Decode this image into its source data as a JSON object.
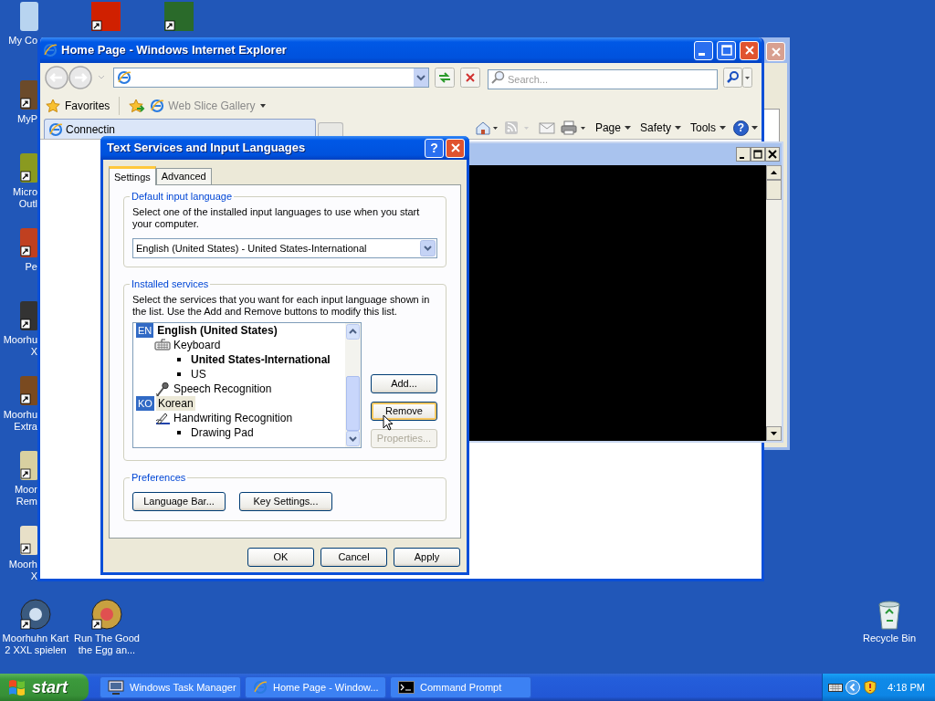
{
  "desktop": {
    "left_icons": [
      {
        "label": "My Co"
      },
      {
        "label": "MyP"
      },
      {
        "label": "Micro\nOutl"
      },
      {
        "label": "Pe"
      },
      {
        "label": "Moorhu\nX"
      },
      {
        "label": "Moorhu\nExtra"
      },
      {
        "label": "Moor\nRem"
      },
      {
        "label": "Moorh\nX"
      }
    ],
    "bottom_icons": [
      {
        "label": "Moorhuhn Kart\n2 XXL spielen"
      },
      {
        "label": "Run The Good\nthe Egg an..."
      }
    ],
    "recycle_bin": {
      "label": "Recycle Bin"
    }
  },
  "ie_window": {
    "title": "Home Page - Windows Internet Explorer",
    "search": {
      "placeholder": "Search..."
    },
    "favorites": "Favorites",
    "web_slice": "Web Slice Gallery",
    "tabs": [
      {
        "label": "Connectin",
        "selected": true
      }
    ],
    "command_bar": [
      {
        "label": "Page"
      },
      {
        "label": "Safety"
      },
      {
        "label": "Tools"
      }
    ],
    "help_button": "?"
  },
  "dialog": {
    "title": "Text Services and Input Languages",
    "help_button": "?",
    "tabs": [
      {
        "label": "Settings",
        "selected": true
      },
      {
        "label": "Advanced",
        "selected": false
      }
    ],
    "default_language": {
      "heading": "Default input language",
      "description": "Select one of the installed input languages to use when you start your computer.",
      "value": "English (United States) - United States-International"
    },
    "installed_services": {
      "heading": "Installed services",
      "description": "Select the services that you want for each input language shown in the list. Use the Add and Remove buttons to modify this list.",
      "tree": [
        {
          "kind": "language",
          "badge": "EN",
          "label": "English (United States)",
          "default": true,
          "selected": false,
          "children": [
            {
              "kind": "keyboard",
              "label": "Keyboard",
              "selected": false,
              "children": [
                {
                  "kind": "layout",
                  "label": "United States-International",
                  "default": true,
                  "selected": false
                },
                {
                  "kind": "layout",
                  "label": "US",
                  "default": false,
                  "selected": false
                }
              ]
            },
            {
              "kind": "speech",
              "label": "Speech Recognition",
              "selected": false
            }
          ]
        },
        {
          "kind": "language",
          "badge": "KO",
          "label": "Korean",
          "default": false,
          "selected": true,
          "children": [
            {
              "kind": "handwriting",
              "label": "Handwriting Recognition",
              "selected": false,
              "children": [
                {
                  "kind": "layout",
                  "label": "Drawing Pad",
                  "default": false,
                  "selected": false
                }
              ]
            }
          ]
        }
      ],
      "buttons": [
        {
          "label": "Add...",
          "disabled": false,
          "focused": false
        },
        {
          "label": "Remove",
          "disabled": false,
          "focused": true
        },
        {
          "label": "Properties...",
          "disabled": true,
          "focused": false
        }
      ]
    },
    "preferences": {
      "heading": "Preferences",
      "buttons": [
        "Language Bar...",
        "Key Settings..."
      ]
    },
    "buttons": [
      "OK",
      "Cancel",
      "Apply"
    ]
  },
  "taskbar": {
    "start": "start",
    "tasks": [
      {
        "kind": "taskmgr",
        "label": "Windows Task Manager"
      },
      {
        "kind": "ie",
        "label": "Home Page - Window..."
      },
      {
        "kind": "cmd",
        "label": "Command Prompt"
      }
    ],
    "clock": "4:18 PM"
  }
}
